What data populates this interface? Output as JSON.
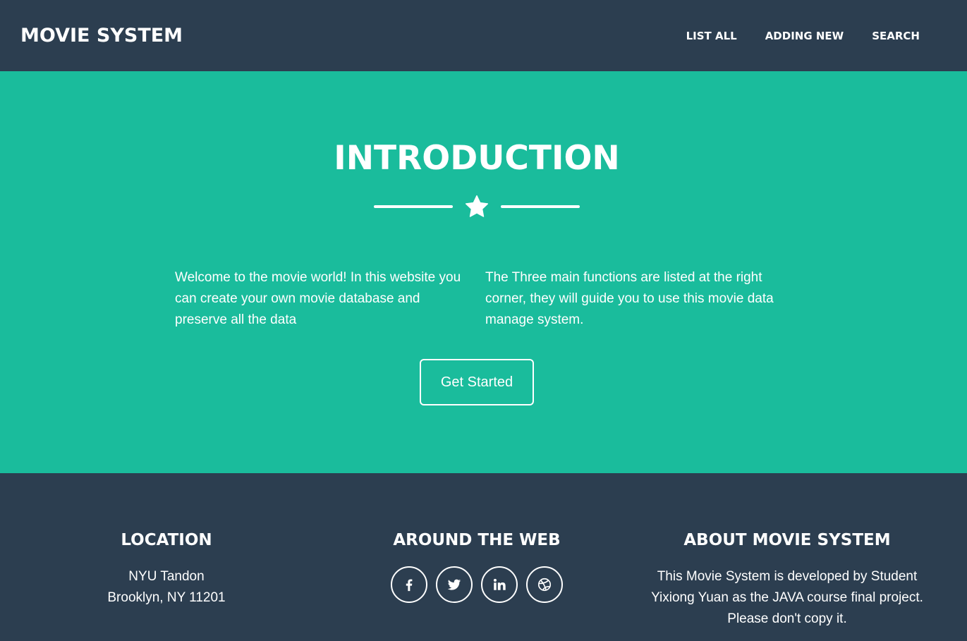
{
  "navbar": {
    "brand": "MOVIE SYSTEM",
    "links": [
      "LIST ALL",
      "ADDING NEW",
      "SEARCH"
    ]
  },
  "hero": {
    "title": "INTRODUCTION",
    "divider_icon": "star-icon",
    "left_text": "Welcome to the movie world! In this website you can create your own movie database and preserve all the data",
    "right_text": "The Three main functions are listed at the right corner, they will guide you to use this movie data manage system.",
    "button_label": "Get Started"
  },
  "footer": {
    "location": {
      "heading": "LOCATION",
      "line1": "NYU Tandon",
      "line2": "Brooklyn, NY 11201"
    },
    "web": {
      "heading": "AROUND THE WEB",
      "icons": [
        "facebook-icon",
        "twitter-icon",
        "linkedin-icon",
        "dribbble-icon"
      ]
    },
    "about": {
      "heading": "ABOUT MOVIE SYSTEM",
      "text": "This Movie System is developed by Student Yixiong Yuan as the JAVA course final project. Please don't copy it."
    }
  },
  "colors": {
    "primary": "#2c3e50",
    "accent": "#1abc9c",
    "text": "#ffffff"
  }
}
